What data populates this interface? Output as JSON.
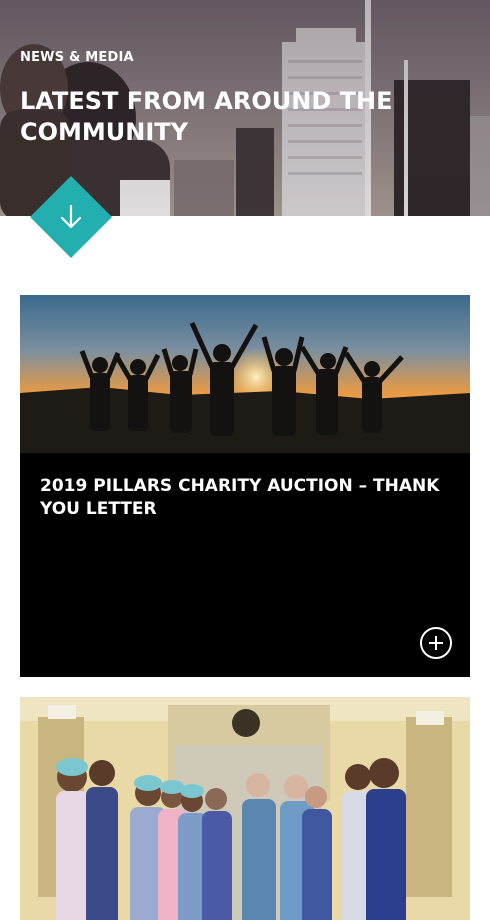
{
  "hero": {
    "eyebrow": "NEWS & MEDIA",
    "title": "LATEST FROM AROUND THE COMMUNITY",
    "scroll_icon": "arrow-down-icon"
  },
  "articles": [
    {
      "title": "2019 PILLARS CHARITY AUCTION – THANK YOU LETTER",
      "image": "silhouettes-sunset-raised-hands",
      "action_icon": "plus-circle-icon"
    },
    {
      "image": "medical-team-group-photo"
    }
  ],
  "colors": {
    "accent": "#23aeb0",
    "card_bg": "#000000",
    "text_light": "#ffffff"
  }
}
